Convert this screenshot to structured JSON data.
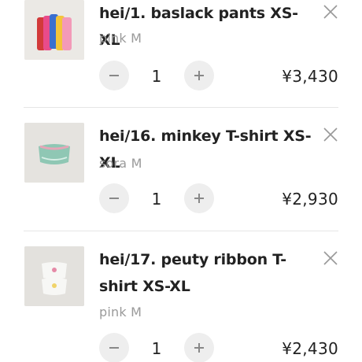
{
  "cart": {
    "items": [
      {
        "title": "hei/1. baslack pants XS-XL",
        "variant": "pink M",
        "quantity": "1",
        "price": "¥3,430"
      },
      {
        "title": "hei/16. minkey T-shirt XS-XL",
        "variant": "sora M",
        "quantity": "1",
        "price": "¥2,930"
      },
      {
        "title": "hei/17. peuty ribbon T-shirt XS-XL",
        "variant": "pink M",
        "quantity": "1",
        "price": "¥2,430"
      }
    ]
  },
  "icons": {
    "remove": "close-icon",
    "decrease": "minus-icon",
    "increase": "plus-icon"
  },
  "colors": {
    "stepper_bg": "#eeeeee",
    "muted_text": "#9a9a9a",
    "divider": "#e6e6e6"
  }
}
